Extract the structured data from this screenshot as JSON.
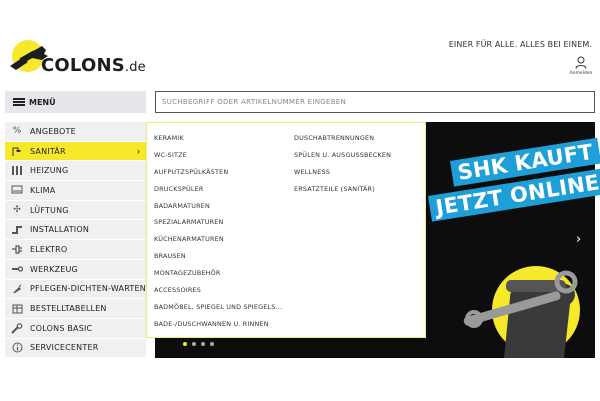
{
  "brand": {
    "name": "COLONS",
    "tld": ".de"
  },
  "header": {
    "tagline": "EINER FÜR ALLE. ALLES BEI EINEM.",
    "account_label": "Anmelden",
    "menu_label": "MENÜ",
    "search_placeholder": "SUCHBEGRIFF ODER ARTIKELNUMMER EINGEBEN"
  },
  "sidebar": {
    "items": [
      {
        "label": "ANGEBOTE",
        "icon": "percent-icon"
      },
      {
        "label": "SANITÄR",
        "icon": "shower-icon",
        "active": true
      },
      {
        "label": "HEIZUNG",
        "icon": "radiator-icon"
      },
      {
        "label": "KLIMA",
        "icon": "air-conditioner-icon"
      },
      {
        "label": "LÜFTUNG",
        "icon": "fan-icon"
      },
      {
        "label": "INSTALLATION",
        "icon": "pipe-icon"
      },
      {
        "label": "ELEKTRO",
        "icon": "plug-icon"
      },
      {
        "label": "WERKZEUG",
        "icon": "tool-icon"
      },
      {
        "label": "PFLEGEN-DICHTEN-WARTEN",
        "icon": "spray-icon"
      },
      {
        "label": "BESTELLTABELLEN",
        "icon": "table-icon"
      },
      {
        "label": "COLONS BASIC",
        "icon": "wrench-icon"
      },
      {
        "label": "SERVICECENTER",
        "icon": "info-icon"
      }
    ]
  },
  "flyout": {
    "col1": [
      "KERAMIK",
      "WC-SITZE",
      "AUFPUTZSPÜLKÄSTEN",
      "DRUCKSPÜLER",
      "BADARMATUREN",
      "SPEZIALARMATUREN",
      "KÜCHENARMATUREN",
      "BRAUSEN",
      "MONTAGEZUBEHÖR",
      "ACCESSOIRES",
      "BADMÖBEL, SPIEGEL UND SPIEGELS...",
      "BADE-/DUSCHWANNEN U. RINNEN"
    ],
    "col2": [
      "DUSCHABTRENNUNGEN",
      "SPÜLEN U. AUSGUSSBECKEN",
      "WELLNESS",
      "ERSATZTEILE (SANITÄR)"
    ]
  },
  "banner": {
    "line1": "SHK KAUFT",
    "line2": "JETZT ONLINE!",
    "slide_count": 4,
    "active_slide": 1
  },
  "colors": {
    "accent": "#f6e82a",
    "promo": "#1f9fd8",
    "banner_bg": "#0d0d0d"
  }
}
